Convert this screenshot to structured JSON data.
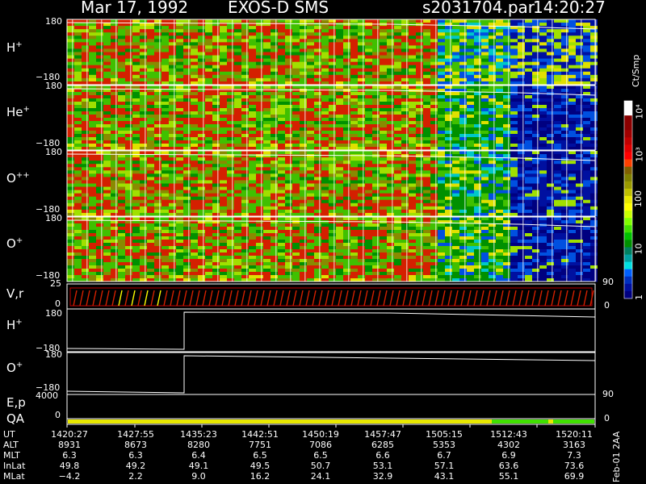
{
  "header": {
    "date": "Mar 17, 1992",
    "instrument": "EXOS-D SMS",
    "file": "s2031704.par",
    "time": "14:20:27"
  },
  "colorbar": {
    "unit": "Ct/Smp",
    "labels": [
      "10⁴",
      "10³",
      "100",
      "10",
      "1"
    ],
    "colors": [
      "#ffffff",
      "#ffffff",
      "#8b0000",
      "#8b0000",
      "#a00000",
      "#c00000",
      "#e00000",
      "#ff0000",
      "#ff4000",
      "#806000",
      "#808000",
      "#9a9a00",
      "#c0c000",
      "#e8e800",
      "#ffff00",
      "#c8ff00",
      "#80ff00",
      "#40e000",
      "#00c000",
      "#009000",
      "#008060",
      "#00a0a0",
      "#00e0e0",
      "#0060ff",
      "#0030c0",
      "#0010a0",
      "#000080"
    ]
  },
  "panels": {
    "h_plus": {
      "label": "H",
      "sup": "+",
      "ymax": "180",
      "ymin": "−180"
    },
    "he_plus": {
      "label": "He",
      "sup": "+",
      "ymax": "180",
      "ymin": "−180"
    },
    "o_plus_plus": {
      "label": "O",
      "sup": "++",
      "ymax": "180",
      "ymin": "−180"
    },
    "o_plus": {
      "label": "O",
      "sup": "+",
      "ymax": "180",
      "ymin": "−180"
    },
    "vr": {
      "label": "V,r",
      "left_top": "25",
      "left_bottom": "0",
      "right_top": "90",
      "right_bottom": "0"
    },
    "h_plus_2": {
      "label": "H",
      "sup": "+",
      "ymax": "180",
      "ymin": "−180"
    },
    "o_plus_2": {
      "label": "O",
      "sup": "+",
      "ymax": "180",
      "ymin": "−180"
    },
    "ep": {
      "label": "E,p",
      "left_top": "4000",
      "right_top": "90"
    },
    "qa": {
      "label": "QA",
      "left_bottom": "0",
      "right_bottom": "0"
    }
  },
  "table": {
    "headers": [
      "UT",
      "ALT",
      "MLT",
      "InLat",
      "MLat"
    ],
    "columns": [
      [
        "1420:27",
        "8931",
        "6.3",
        "49.8",
        "−4.2"
      ],
      [
        "1427:55",
        "8673",
        "6.3",
        "49.2",
        "2.2"
      ],
      [
        "1435:23",
        "8280",
        "6.4",
        "49.1",
        "9.0"
      ],
      [
        "1442:51",
        "7751",
        "6.5",
        "49.5",
        "16.2"
      ],
      [
        "1450:19",
        "7086",
        "6.5",
        "50.7",
        "24.1"
      ],
      [
        "1457:47",
        "6285",
        "6.6",
        "53.1",
        "32.9"
      ],
      [
        "1505:15",
        "5353",
        "6.7",
        "57.1",
        "43.1"
      ],
      [
        "1512:43",
        "4302",
        "6.9",
        "63.6",
        "55.1"
      ],
      [
        "1520:11",
        "3163",
        "7.3",
        "73.6",
        "69.9"
      ]
    ],
    "footer": "Feb-01 2AA"
  },
  "chart_data": {
    "type": "heatmap",
    "x": [
      "1420:27",
      "1427:55",
      "1435:23",
      "1442:51",
      "1450:19",
      "1457:47",
      "1505:15",
      "1512:43",
      "1520:11"
    ],
    "panels": [
      "H+",
      "He+",
      "O++",
      "O+"
    ],
    "ylim": [
      -180,
      180
    ],
    "series": [
      {
        "name": "H+",
        "values": [
          -180,
          -180,
          180,
          180,
          180,
          180,
          180,
          175,
          172
        ]
      },
      {
        "name": "O+",
        "values": [
          -180,
          -180,
          180,
          180,
          180,
          178,
          176,
          174,
          172
        ]
      }
    ],
    "qa": [
      1,
      1,
      1,
      1,
      1,
      1,
      1,
      2,
      2
    ]
  }
}
